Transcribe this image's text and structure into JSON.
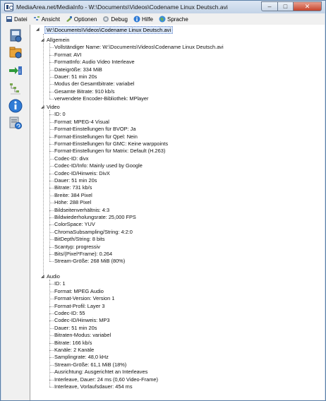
{
  "window": {
    "title": "MediaArea.net/MediaInfo - W:\\Documents\\Videos\\Codename Linux Deutsch.avi",
    "min_glyph": "–",
    "max_glyph": "□",
    "close_glyph": "✕"
  },
  "menu": [
    {
      "label": "Datei",
      "icon": "file-icon"
    },
    {
      "label": "Ansicht",
      "icon": "view-icon"
    },
    {
      "label": "Optionen",
      "icon": "options-icon"
    },
    {
      "label": "Debug",
      "icon": "debug-icon"
    },
    {
      "label": "Hilfe",
      "icon": "help-icon"
    },
    {
      "label": "Sprache",
      "icon": "language-icon"
    }
  ],
  "sidebar": [
    {
      "name": "open-file-icon"
    },
    {
      "name": "open-folder-icon"
    },
    {
      "name": "export-icon"
    },
    {
      "name": "tree-view-icon"
    },
    {
      "name": "info-icon"
    },
    {
      "name": "check-updates-icon"
    }
  ],
  "tree": {
    "root": "W:\\Documents\\Videos\\Codename Linux Deutsch.avi",
    "sections": [
      {
        "name": "Allgemein",
        "items": [
          "Vollständiger Name: W:\\Documents\\Videos\\Codename Linux Deutsch.avi",
          "Format: AVI",
          "FormatInfo: Audio Video Interleave",
          "Dateigröße: 334 MiB",
          "Dauer: 51 min 20s",
          "Modus der Gesamtbitrate: variabel",
          "Gesamte Bitrate: 910 kb/s",
          "verwendete Encoder-Bibliothek: MPlayer"
        ]
      },
      {
        "name": "Video",
        "items": [
          "ID: 0",
          "Format: MPEG-4 Visual",
          "Format-Einstellungen für BVOP: Ja",
          "Format-Einstellungen für Qpel: Nein",
          "Format-Einstellungen für GMC:  Keine warppoints",
          "Format-Einstellungen für Matrix: Default (H.263)",
          "Codec-ID: divx",
          "Codec-ID/Info: Mainly used by Google",
          "Codec-ID/Hinweis: DivX",
          "Dauer: 51 min 20s",
          "Bitrate: 731 kb/s",
          "Breite: 384 Pixel",
          "Höhe: 288 Pixel",
          "Bildseitenverhältnis: 4:3",
          "Bildwiederholungsrate: 25,000 FPS",
          "ColorSpace: YUV",
          "ChromaSubsampling/String: 4:2:0",
          "BitDepth/String: 8 bits",
          "Scantyp: progressiv",
          "Bits/(Pixel*Frame): 0.264",
          "Stream-Größe: 268 MiB (80%)"
        ]
      },
      {
        "name": "Audio",
        "items": [
          "ID: 1",
          "Format: MPEG Audio",
          "Format-Version: Version 1",
          "Format-Profil: Layer 3",
          "Codec-ID: 55",
          "Codec-ID/Hinweis: MP3",
          "Dauer: 51 min 20s",
          "Bitraten-Modus: variabel",
          "Bitrate: 166 kb/s",
          "Kanäle: 2 Kanäle",
          "Samplingrate: 48,0 kHz",
          "Stream-Größe: 61,1 MiB (18%)",
          "Ausrichtung: Ausgerichtet an Interleaves",
          "Interleave, Dauer: 24  ms (0,60 Video-Frame)",
          "Interleave, Vorlaufsdauer: 454  ms"
        ]
      }
    ]
  }
}
